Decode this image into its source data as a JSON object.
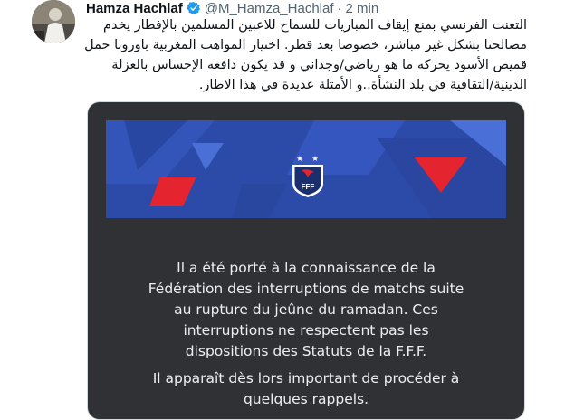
{
  "tweet": {
    "author_name": "Hamza Hachlaf",
    "handle": "@M_Hamza_Hachlaf",
    "separator": "·",
    "time": "2 min",
    "body_lines": [
      "التعنت الفرنسي بمنع إيقاف المباريات للسماح للاعبين المسلمين بالإفطار يخدم",
      "مصالحنا بشكل غير مباشر، خصوصا بعد قطر. اختيار المواهب المغربية باوروبا حمل",
      "قميص الأسود يحركه ما هو رياضي/وجداني و قد يكون دافعه الإحساس بالعزلة",
      "الدينية/الثقافية في بلد النشأة..و الأمثلة عديدة في هذا الاطار."
    ]
  },
  "media": {
    "crest_text": "FFF",
    "paragraph1": [
      "Il a été porté à la connaissance de la",
      "Fédération des interruptions de matchs suite",
      "au rupture du jeûne du ramadan. Ces",
      "interruptions ne respectent pas les",
      "dispositions des Statuts de la F.F.F."
    ],
    "paragraph2": [
      "Il apparaît dès lors important de procéder à",
      "quelques rappels."
    ]
  },
  "colors": {
    "verified": "#1d9bf0",
    "banner_blue": "#2c4aa8",
    "accent_red": "#e4252f",
    "media_bg": "#303134"
  },
  "icons": {
    "verified": "verified-badge-icon",
    "crest": "fff-crest-icon"
  }
}
